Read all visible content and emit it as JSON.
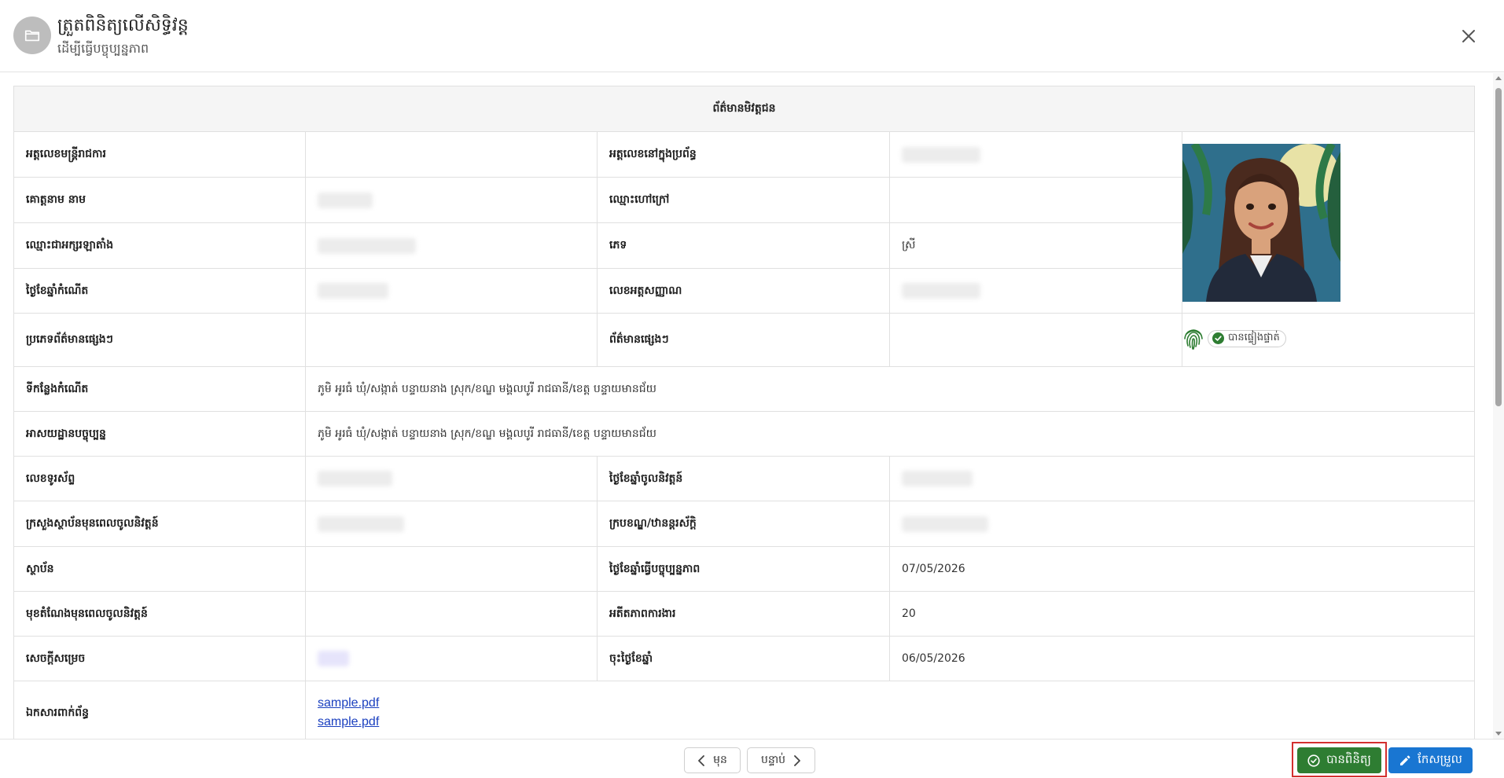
{
  "header": {
    "title": "ត្រួតពិនិត្យលើសិទ្ធិវន្ត",
    "subtitle": "ដើម្បីធ្វើបច្ចុប្បន្នភាព"
  },
  "table": {
    "title": "ព័ត៌មានមិវត្តជន",
    "rows": {
      "officer_id_label": "អត្តលេខមន្ត្រីរាជការ",
      "system_id_label": "អត្តលេខនៅក្នុងប្រព័ន្ធ",
      "name_label": "គោត្តនាម នាម",
      "nickname_label": "ឈ្មោះហៅក្រៅ",
      "latin_name_label": "ឈ្មោះជាអក្សរឡាតាំង",
      "gender_label": "ភេទ",
      "gender_value": "ស្រី",
      "dob_label": "ថ្ងៃខែឆ្នាំកំណើត",
      "id_card_label": "លេខអត្តសញ្ញាណ",
      "other_info_type_label": "ប្រភេទព័ត៌មានផ្សេងៗ",
      "other_info_label": "ព័ត៌មានផ្សេងៗ",
      "biometric_badge": "បានផ្ទៀងផ្ទាត់",
      "birthplace_label": "ទីកន្លែងកំណើត",
      "birthplace_value": "ភូមិ អូរធំ ឃុំ/សង្កាត់ បន្ទាយនាង ស្រុក/ខណ្ឌ មង្គលបូរី រាជធានី/ខេត្ត បន្ទាយមានជ័យ",
      "address_label": "អាសយដ្ឋានបច្ចុប្បន្ន",
      "address_value": "ភូមិ អូរធំ ឃុំ/សង្កាត់ បន្ទាយនាង ស្រុក/ខណ្ឌ មង្គលបូរី រាជធានី/ខេត្ត បន្ទាយមានជ័យ",
      "phone_label": "លេខទូរស័ព្ទ",
      "retire_date_label": "ថ្ងៃខែឆ្នាំចូលនិវត្តន៍",
      "ministry_label": "ក្រសួងស្ថាប័នមុនពេលចូលនិវត្តន៍",
      "rank_label": "ក្របខណ្ឌ/ឋានន្តរស័ក្តិ",
      "institution_label": "ស្ថាប័ន",
      "update_date_label": "ថ្ងៃខែឆ្នាំធ្វើបច្ចុប្បន្នភាព",
      "update_date_value": "07/05/2026",
      "position_label": "មុខតំណែងមុនពេលចូលនិវត្តន៍",
      "years_label": "អតីតភាពការងារ",
      "years_value": "20",
      "decision_label": "សេចក្តីសម្រេច",
      "signed_date_label": "ចុះថ្ងៃខែឆ្នាំ",
      "signed_date_value": "06/05/2026",
      "attachments_label": "ឯកសារពាក់ព័ន្ធ",
      "attachments": [
        "sample.pdf",
        "sample.pdf"
      ]
    }
  },
  "footer": {
    "prev_label": "មុន",
    "next_label": "បន្ទាប់",
    "checked_label": "បានពិនិត្យ",
    "edit_label": "កែសម្រួល"
  },
  "colors": {
    "checked_button": "#2e7d32",
    "edit_button": "#1976d2",
    "highlight": "#d32f2f",
    "link": "#1a3fbf"
  }
}
